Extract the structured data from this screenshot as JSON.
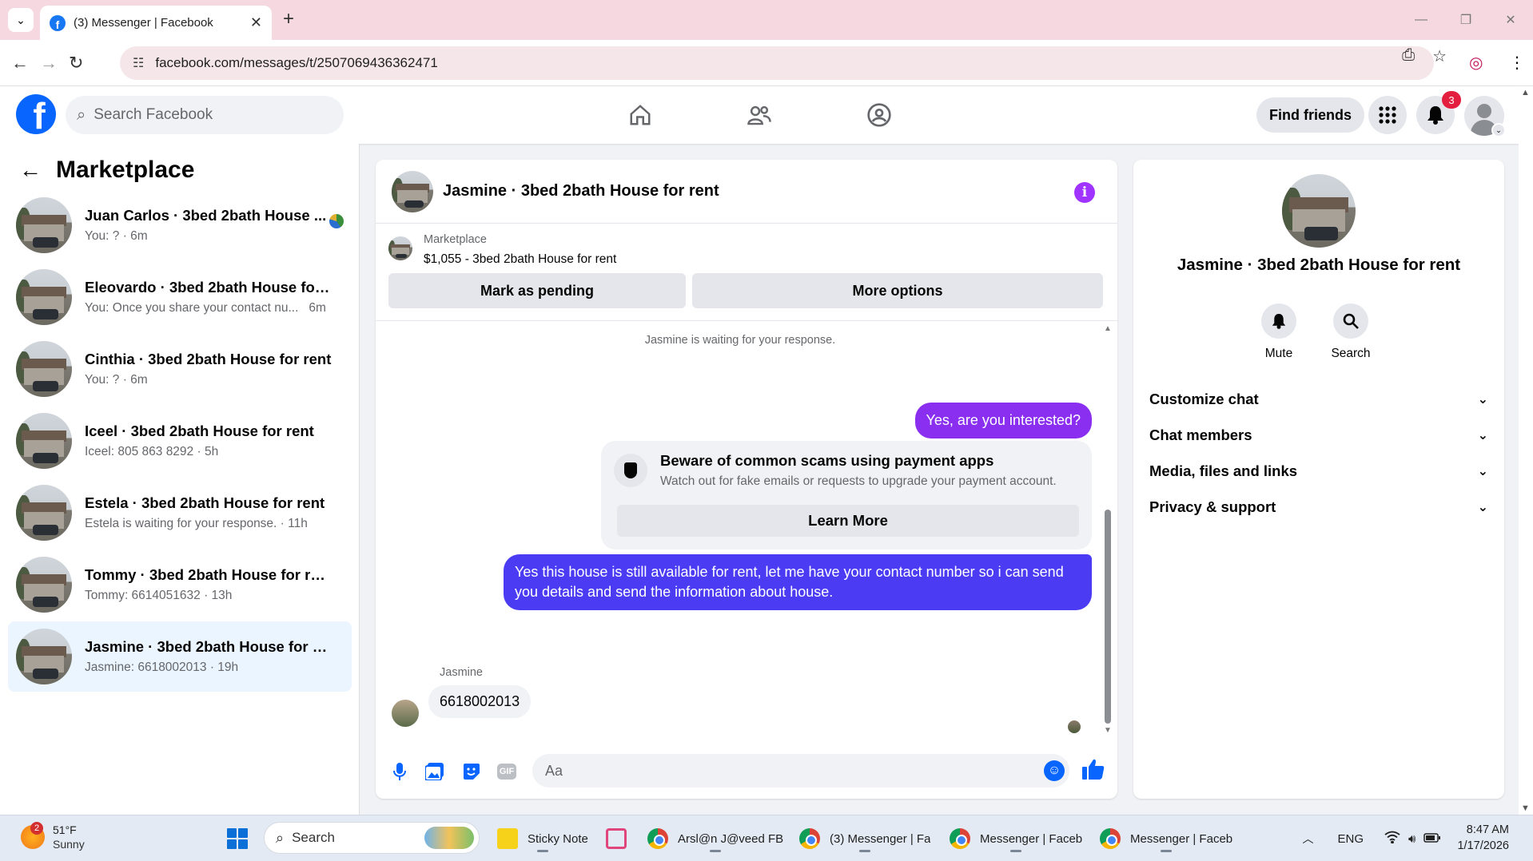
{
  "browser": {
    "tab_title": "(3) Messenger | Facebook",
    "url": "facebook.com/messages/t/2507069436362471"
  },
  "fb": {
    "search_placeholder": "Search Facebook",
    "find_friends": "Find friends",
    "notification_count": "3"
  },
  "sidebar": {
    "title": "Marketplace",
    "conversations": [
      {
        "name": "Juan Carlos · 3bed 2bath House ...",
        "preview": "You: ? · 6m",
        "active": false
      },
      {
        "name": "Eleovardo · 3bed 2bath House for ...",
        "preview": "You: Once you share your contact nu...",
        "time": "6m",
        "active": false
      },
      {
        "name": "Cinthia · 3bed 2bath House for rent",
        "preview": "You: ? · 6m",
        "active": false
      },
      {
        "name": "Iceel · 3bed 2bath House for rent",
        "preview": "Iceel: 805 863 8292 · 5h",
        "active": false
      },
      {
        "name": "Estela · 3bed 2bath House for rent",
        "preview": "Estela is waiting for your response. · 11h",
        "active": false
      },
      {
        "name": "Tommy · 3bed 2bath House for rent",
        "preview": "Tommy: 6614051632 · 13h",
        "active": false
      },
      {
        "name": "Jasmine · 3bed 2bath House for rent",
        "preview": "Jasmine: 6618002013 · 19h",
        "active": true
      }
    ]
  },
  "chat": {
    "title": "Jasmine · 3bed 2bath House for rent",
    "listing_source": "Marketplace",
    "listing_price_title": "$1,055 - 3bed 2bath House for rent",
    "mark_pending": "Mark as pending",
    "more_options": "More options",
    "system_note": "Jasmine is waiting for your response.",
    "messages": {
      "out_1": "Yes, are you interested?",
      "scam_title": "Beware of common scams using payment apps",
      "scam_desc": "Watch out for fake emails or requests to upgrade your payment account.",
      "learn_more": "Learn More",
      "out_2": "Yes this house is still available for rent, let me have your contact number so i can send you details and send the information about house.",
      "in_sender": "Jasmine",
      "in_1": "6618002013"
    },
    "composer_placeholder": "Aa",
    "gif_label": "GIF"
  },
  "info_panel": {
    "name": "Jasmine · 3bed 2bath House for rent",
    "mute": "Mute",
    "search": "Search",
    "sections": [
      "Customize chat",
      "Chat members",
      "Media, files and links",
      "Privacy & support"
    ]
  },
  "taskbar": {
    "weather_temp": "51°F",
    "weather_cond": "Sunny",
    "weather_badge": "2",
    "search": "Search",
    "apps": [
      {
        "label": "Sticky Note",
        "icon": "sticky-notes-icon"
      },
      {
        "label": "Arsl@n J@veed FB",
        "icon": "chrome-icon"
      },
      {
        "label": "(3) Messenger | Fa",
        "icon": "chrome-icon"
      },
      {
        "label": "Messenger | Faceb",
        "icon": "chrome-icon"
      },
      {
        "label": "Messenger | Faceb",
        "icon": "chrome-icon"
      }
    ],
    "lang": "ENG",
    "time": "8:47 AM",
    "date": "1/17/2026"
  }
}
